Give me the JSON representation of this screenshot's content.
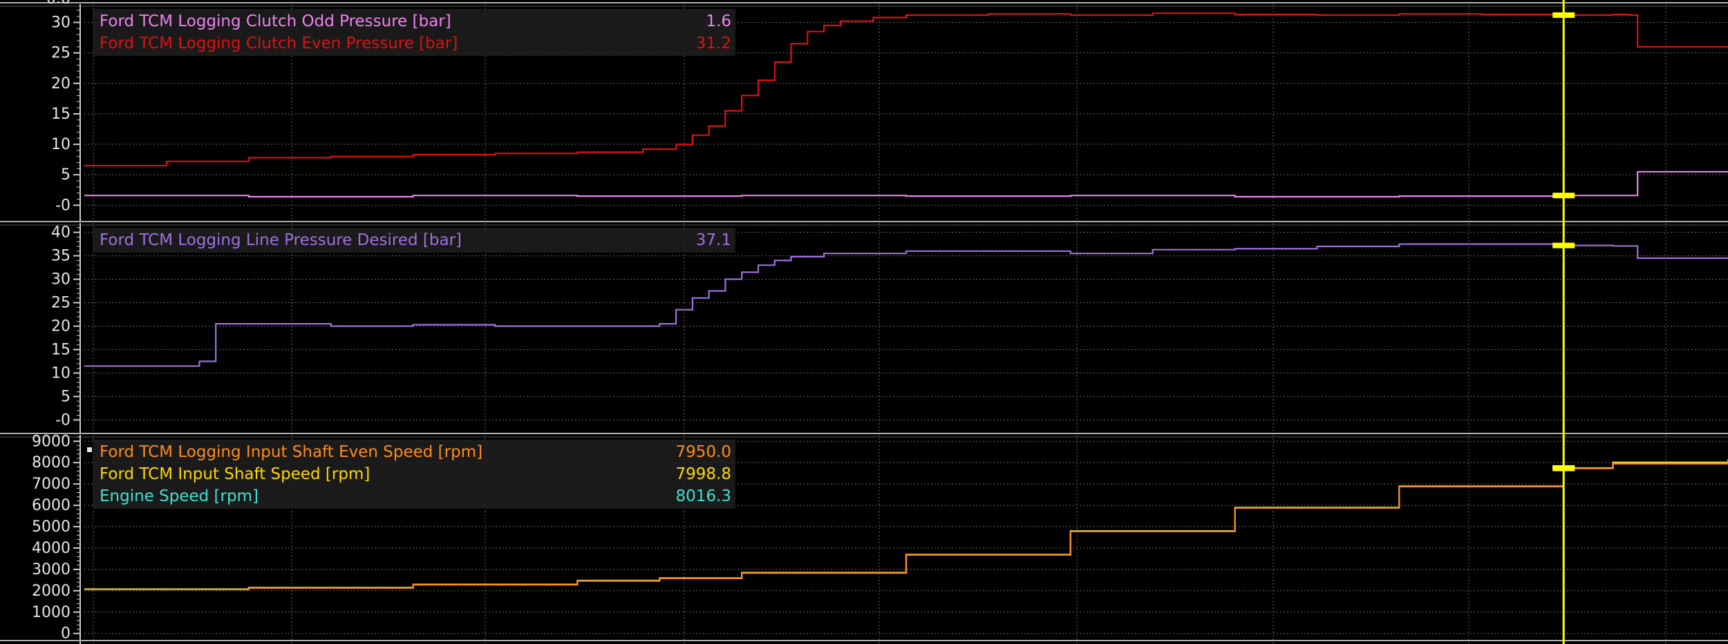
{
  "colors": {
    "background": "#000000",
    "grid": "#6a6a6a",
    "axis": "#cfcfcf",
    "cursor": "#ffff00",
    "panel_divider": "#b0b0b0",
    "legend_bg": "#1e1e1e"
  },
  "cursor_x": 0.9,
  "chart_data": [
    {
      "type": "line",
      "ylim": [
        -2,
        33
      ],
      "ytick_values": [
        0,
        5,
        10,
        15,
        20,
        25,
        30
      ],
      "ytick_labels": [
        "-0",
        "5",
        "10",
        "15",
        "20",
        "25",
        "30"
      ],
      "top_partial_label": "0.0",
      "legend": [
        {
          "name": "Ford TCM Logging Clutch Odd Pressure [bar]",
          "value": "1.6",
          "color": "#ee82ee"
        },
        {
          "name": "Ford TCM Logging Clutch Even Pressure [bar]",
          "value": "31.2",
          "color": "#e01010"
        }
      ],
      "series": [
        {
          "name": "Ford TCM Logging Clutch Even Pressure [bar]",
          "color": "#e01010",
          "x": [
            0,
            0.05,
            0.1,
            0.15,
            0.2,
            0.25,
            0.3,
            0.34,
            0.36,
            0.37,
            0.38,
            0.39,
            0.4,
            0.41,
            0.42,
            0.43,
            0.44,
            0.45,
            0.46,
            0.48,
            0.5,
            0.55,
            0.6,
            0.65,
            0.7,
            0.75,
            0.8,
            0.85,
            0.9,
            0.93,
            0.94,
            0.945,
            1.0
          ],
          "y": [
            6.5,
            7.2,
            7.8,
            8.0,
            8.3,
            8.5,
            8.7,
            9.2,
            10.0,
            11.5,
            13.0,
            15.5,
            18.0,
            20.5,
            23.5,
            26.5,
            28.5,
            29.5,
            30.2,
            30.8,
            31.2,
            31.4,
            31.2,
            31.5,
            31.3,
            31.2,
            31.4,
            31.3,
            31.2,
            31.3,
            31.2,
            26.0,
            26.0
          ]
        },
        {
          "name": "Ford TCM Logging Clutch Odd Pressure [bar]",
          "color": "#ee82ee",
          "x": [
            0,
            0.1,
            0.2,
            0.3,
            0.4,
            0.5,
            0.6,
            0.7,
            0.8,
            0.9,
            0.93,
            0.94,
            0.945,
            1.0
          ],
          "y": [
            1.6,
            1.4,
            1.6,
            1.5,
            1.6,
            1.5,
            1.6,
            1.4,
            1.5,
            1.6,
            1.6,
            1.6,
            5.5,
            5.5
          ]
        }
      ]
    },
    {
      "type": "line",
      "ylim": [
        -2,
        42
      ],
      "ytick_values": [
        0,
        5,
        10,
        15,
        20,
        25,
        30,
        35,
        40
      ],
      "ytick_labels": [
        "-0",
        "5",
        "10",
        "15",
        "20",
        "25",
        "30",
        "35",
        "40"
      ],
      "legend": [
        {
          "name": "Ford TCM Logging Line Pressure Desired [bar]",
          "value": "37.1",
          "color": "#a070e0"
        }
      ],
      "series": [
        {
          "name": "Ford TCM Logging Line Pressure Desired [bar]",
          "color": "#a070e0",
          "x": [
            0,
            0.06,
            0.07,
            0.075,
            0.08,
            0.1,
            0.15,
            0.2,
            0.25,
            0.3,
            0.34,
            0.35,
            0.36,
            0.37,
            0.38,
            0.39,
            0.4,
            0.41,
            0.42,
            0.43,
            0.45,
            0.5,
            0.55,
            0.6,
            0.65,
            0.7,
            0.75,
            0.8,
            0.85,
            0.9,
            0.93,
            0.94,
            0.945,
            1.0
          ],
          "y": [
            11.5,
            11.5,
            12.5,
            12.5,
            20.5,
            20.5,
            20.0,
            20.3,
            20.0,
            20.0,
            20.0,
            20.5,
            23.5,
            26.0,
            27.5,
            30.0,
            31.5,
            33.0,
            34.0,
            34.8,
            35.5,
            36.0,
            36.0,
            35.5,
            36.3,
            36.5,
            37.0,
            37.5,
            37.5,
            37.2,
            37.1,
            37.1,
            34.5,
            34.5
          ]
        }
      ]
    },
    {
      "type": "line",
      "ylim": [
        -300,
        9300
      ],
      "ytick_values": [
        0,
        1000,
        2000,
        3000,
        4000,
        5000,
        6000,
        7000,
        8000,
        9000
      ],
      "ytick_labels": [
        "0",
        "1000",
        "2000",
        "3000",
        "4000",
        "5000",
        "6000",
        "7000",
        "8000",
        "9000"
      ],
      "legend": [
        {
          "name": "Ford TCM Logging Input Shaft Even Speed [rpm]",
          "value": "7950.0",
          "color": "#ff8c1a"
        },
        {
          "name": "Ford TCM Input Shaft Speed [rpm]",
          "value": "7998.8",
          "color": "#ffd700"
        },
        {
          "name": "Engine Speed [rpm]",
          "value": "8016.3",
          "color": "#40e0d0"
        }
      ],
      "series": [
        {
          "name": "Engine Speed [rpm]",
          "color": "#40e0d0",
          "x": [
            0,
            0.1,
            0.2,
            0.3,
            0.35,
            0.4,
            0.5,
            0.6,
            0.7,
            0.8,
            0.9,
            0.93,
            1.0
          ],
          "y": [
            2080,
            2150,
            2300,
            2480,
            2600,
            2850,
            3700,
            4800,
            5900,
            6900,
            7750,
            8016,
            8150
          ]
        },
        {
          "name": "Ford TCM Input Shaft Speed [rpm]",
          "color": "#ffd700",
          "x": [
            0,
            0.1,
            0.2,
            0.3,
            0.35,
            0.4,
            0.5,
            0.6,
            0.7,
            0.8,
            0.9,
            0.93,
            1.0
          ],
          "y": [
            2070,
            2140,
            2290,
            2470,
            2590,
            2840,
            3690,
            4790,
            5890,
            6890,
            7740,
            7999,
            8140
          ]
        },
        {
          "name": "Ford TCM Logging Input Shaft Even Speed [rpm]",
          "color": "#ff8c1a",
          "x": [
            0,
            0.1,
            0.2,
            0.3,
            0.35,
            0.4,
            0.5,
            0.6,
            0.7,
            0.8,
            0.9,
            0.93,
            1.0
          ],
          "y": [
            2060,
            2130,
            2280,
            2460,
            2580,
            2830,
            3680,
            4780,
            5880,
            6880,
            7730,
            7950,
            8130
          ]
        }
      ]
    }
  ]
}
